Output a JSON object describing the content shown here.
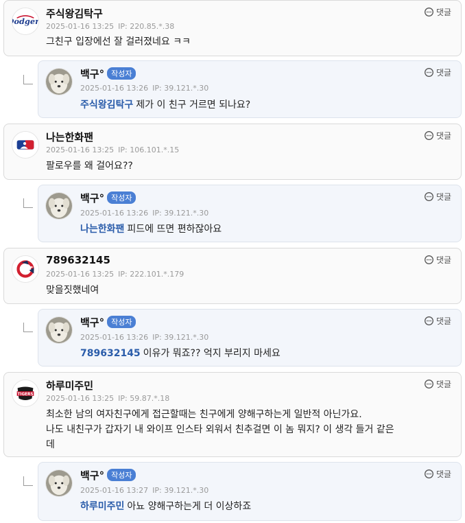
{
  "reply_label": "댓글",
  "writer_badge": "작성자",
  "ip_prefix": "IP:",
  "comments": [
    {
      "nick": "주식왕김탁구",
      "time": "2025-01-16 13:25",
      "ip": "220.85.*.38",
      "text": "그친구 입장에선 잘 걸러졌네요 ㅋㅋ",
      "avatar": "dodgers-logo-icon"
    },
    {
      "nick": "백구°",
      "time": "2025-01-16 13:26",
      "ip": "39.121.*.30",
      "mention": "주식왕김탁구",
      "text": "제가 이 친구 거르면 되나요?",
      "avatar": "white-dog-photo-icon"
    },
    {
      "nick": "나는한화팬",
      "time": "2025-01-16 13:25",
      "ip": "106.101.*.15",
      "text": "팔로우를 왜 걸어요??",
      "avatar": "mlb-logo-icon"
    },
    {
      "nick": "백구°",
      "time": "2025-01-16 13:26",
      "ip": "39.121.*.30",
      "mention": "나는한화팬",
      "text": "피드에 뜨면 편하잖아요",
      "avatar": "white-dog-photo-icon"
    },
    {
      "nick": "789632145",
      "time": "2025-01-16 13:25",
      "ip": "222.101.*.179",
      "text": "맞을짓했네여",
      "avatar": "guardians-logo-icon"
    },
    {
      "nick": "백구°",
      "time": "2025-01-16 13:26",
      "ip": "39.121.*.30",
      "mention": "789632145",
      "text": "이유가 뭐죠?? 억지 부리지 마세요",
      "avatar": "white-dog-photo-icon"
    },
    {
      "nick": "하루미주민",
      "time": "2025-01-16 13:25",
      "ip": "59.87.*.18",
      "text_lines": [
        "최소한 남의 여자친구에게 접근할때는 친구에게 양해구하는게 일반적 아닌가요.",
        "나도 내친구가 갑자기 내 와이프 인스타 외워서 친추걸면 이 놈 뭐지? 이 생각 들거 같은",
        "데"
      ],
      "avatar": "tigers-logo-icon"
    },
    {
      "nick": "백구°",
      "time": "2025-01-16 13:27",
      "ip": "39.121.*.30",
      "mention": "하루미주민",
      "text": "아뇨 양해구하는게 더 이상하죠",
      "avatar": "white-dog-photo-icon"
    }
  ]
}
